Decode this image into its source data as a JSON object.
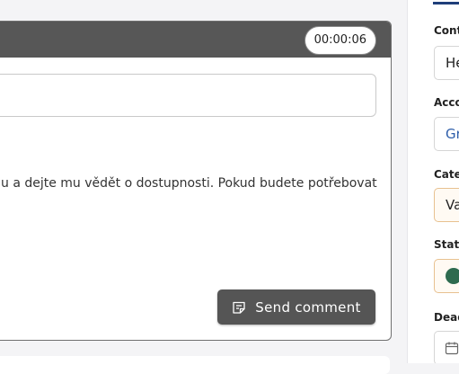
{
  "ticket": {
    "timer": "00:00:06",
    "comment_text": "u a dejte mu vědět o dostupnosti. Pokud budete potřebovat",
    "send_label": "Send comment"
  },
  "sidebar": {
    "contact_label": "Cont",
    "contact_value": "He",
    "account_label": "Acco",
    "account_value": "Gr",
    "category_label": "Cate",
    "category_value": "Va",
    "state_label": "State",
    "deadline_label": "Dead"
  },
  "colors": {
    "header": "#575757",
    "button": "#555555",
    "link": "#2e5eaa",
    "state_dot": "#2e6b4f",
    "accent_line": "#1f3e7a"
  }
}
